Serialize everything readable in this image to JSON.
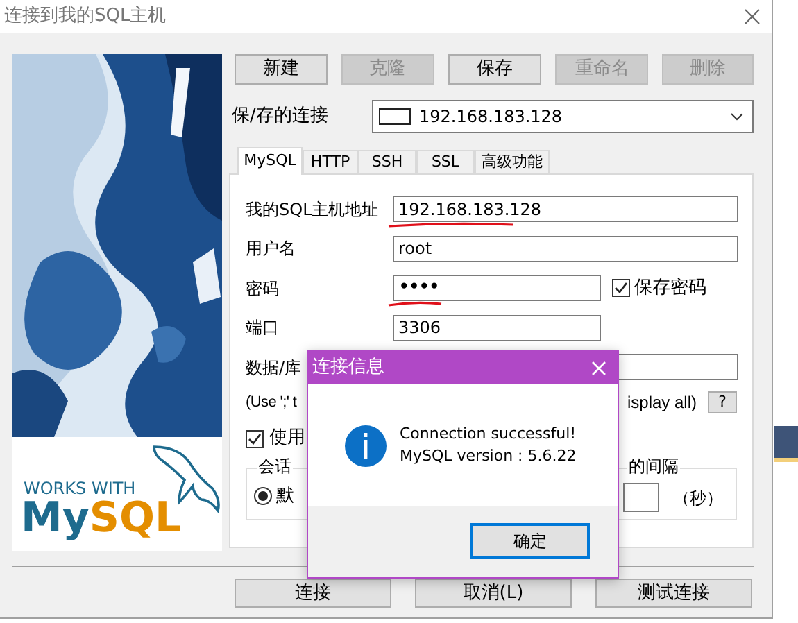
{
  "window": {
    "title": "连接到我的SQL主机"
  },
  "toolbar": [
    {
      "label": "新建",
      "disabled": false
    },
    {
      "label": "克隆",
      "disabled": true
    },
    {
      "label": "保存",
      "disabled": false
    },
    {
      "label": "重命名",
      "disabled": true
    },
    {
      "label": "删除",
      "disabled": true
    }
  ],
  "saved_connection": {
    "label": "保/存的连接",
    "value": "192.168.183.128"
  },
  "tabs": [
    {
      "label": "MySQL",
      "selected": true
    },
    {
      "label": "HTTP",
      "selected": false
    },
    {
      "label": "SSH",
      "selected": false
    },
    {
      "label": "SSL",
      "selected": false
    },
    {
      "label": "高级功能",
      "selected": false
    }
  ],
  "fields": [
    {
      "label": "我的SQL主机地址",
      "value": "192.168.183.128",
      "kind": "wide",
      "underlined": true
    },
    {
      "label": "用户名",
      "value": "root",
      "kind": "wide",
      "underlined": false
    },
    {
      "label": "密码",
      "value": "••••",
      "kind": "password",
      "underlined": true,
      "checkbox": {
        "label": "保存密码",
        "checked": true
      }
    },
    {
      "label": "端口",
      "value": "3306",
      "kind": "narrow",
      "underlined": false
    },
    {
      "label": "数据/库",
      "kind": "wide",
      "underlined": false
    }
  ],
  "database_hint": {
    "left": "(Use ';' t",
    "right": "isplay all)",
    "help": "?"
  },
  "use_checkbox": {
    "label": "使用",
    "checked": true
  },
  "session_group": {
    "legend": "会话",
    "right_label": "的间隔",
    "radio": {
      "label": "默",
      "selected": true
    },
    "unit": "（秒）"
  },
  "footer_buttons": [
    "连接",
    "取消(L)",
    "测试连接"
  ],
  "logo": {
    "caption": "WORKS WITH",
    "part_1": "My",
    "part_2": "SQL"
  },
  "dialog": {
    "title": "连接信息",
    "lines": [
      "Connection successful!",
      "MySQL version : 5.6.22"
    ],
    "ok": "确定"
  }
}
